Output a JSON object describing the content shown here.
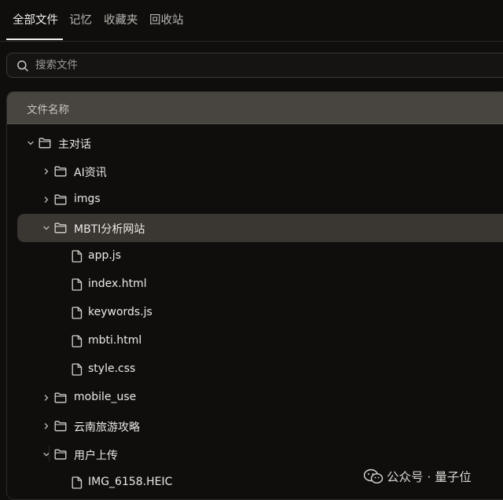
{
  "tabs": [
    {
      "label": "全部文件",
      "active": true
    },
    {
      "label": "记忆",
      "active": false
    },
    {
      "label": "收藏夹",
      "active": false
    },
    {
      "label": "回收站",
      "active": false
    }
  ],
  "search": {
    "placeholder": "搜索文件",
    "icon": "search-icon"
  },
  "file_tree": {
    "header": "文件名称",
    "items": [
      {
        "label": "主对话",
        "type": "folder",
        "depth": 0,
        "expanded": true,
        "icon": "folder-icon"
      },
      {
        "label": "AI资讯",
        "type": "folder",
        "depth": 1,
        "expanded": false,
        "icon": "folder-icon"
      },
      {
        "label": "imgs",
        "type": "folder",
        "depth": 1,
        "expanded": false,
        "icon": "folder-icon"
      },
      {
        "label": "MBTI分析网站",
        "type": "folder",
        "depth": 1,
        "expanded": true,
        "selected": true,
        "icon": "folder-icon"
      },
      {
        "label": "app.js",
        "type": "file",
        "depth": 2,
        "icon": "file-icon"
      },
      {
        "label": "index.html",
        "type": "file",
        "depth": 2,
        "icon": "file-icon"
      },
      {
        "label": "keywords.js",
        "type": "file",
        "depth": 2,
        "icon": "file-icon"
      },
      {
        "label": "mbti.html",
        "type": "file",
        "depth": 2,
        "icon": "file-icon"
      },
      {
        "label": "style.css",
        "type": "file",
        "depth": 2,
        "icon": "file-icon"
      },
      {
        "label": "mobile_use",
        "type": "folder",
        "depth": 1,
        "expanded": false,
        "icon": "folder-icon"
      },
      {
        "label": "云南旅游攻略",
        "type": "folder",
        "depth": 1,
        "expanded": false,
        "icon": "folder-icon"
      },
      {
        "label": "用户上传",
        "type": "folder",
        "depth": 1,
        "expanded": true,
        "icon": "folder-icon"
      },
      {
        "label": "IMG_6158.HEIC",
        "type": "file",
        "depth": 2,
        "icon": "file-icon"
      }
    ]
  },
  "watermark": {
    "text": "公众号 · 量子位",
    "icon": "wechat-icon"
  }
}
